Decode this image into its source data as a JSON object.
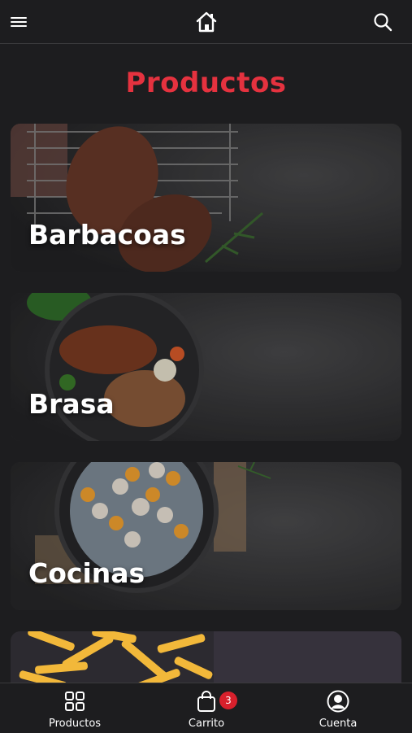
{
  "header": {
    "menu_icon": "hamburger-menu-icon",
    "home_icon": "home-icon",
    "search_icon": "search-icon"
  },
  "page": {
    "title": "Productos",
    "title_color": "#e5323f"
  },
  "categories": [
    {
      "label": "Barbacoas"
    },
    {
      "label": "Brasa"
    },
    {
      "label": "Cocinas"
    },
    {
      "label": ""
    }
  ],
  "bottom_nav": {
    "items": [
      {
        "label": "Productos",
        "icon": "grid-icon"
      },
      {
        "label": "Carrito",
        "icon": "shopping-bag-icon",
        "badge": "3"
      },
      {
        "label": "Cuenta",
        "icon": "user-account-icon"
      }
    ],
    "badge_color": "#d8202c"
  }
}
